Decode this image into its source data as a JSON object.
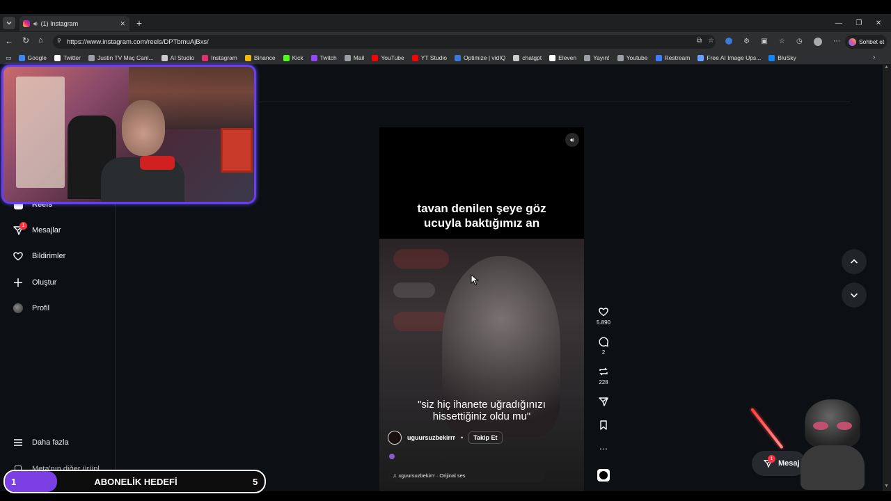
{
  "browser": {
    "tab_title": "(1) Instagram",
    "url": "https://www.instagram.com/reels/DPTbmuAjBxs/",
    "copilot_label": "Sohbet et",
    "bookmarks": [
      {
        "label": "Google",
        "color": "#4285f4"
      },
      {
        "label": "Twitter",
        "color": "#ffffff"
      },
      {
        "label": "Justin TV Maç Canl...",
        "color": "#9aa0a6"
      },
      {
        "label": "AI Studio",
        "color": "#cccccc"
      },
      {
        "label": "Instagram",
        "color": "#e1306c"
      },
      {
        "label": "Binance",
        "color": "#f0b90b"
      },
      {
        "label": "Kick",
        "color": "#53fc18"
      },
      {
        "label": "Twitch",
        "color": "#9146ff"
      },
      {
        "label": "Mail",
        "color": "#9aa0a6"
      },
      {
        "label": "YouTube",
        "color": "#ff0000"
      },
      {
        "label": "YT Studio",
        "color": "#ff0000"
      },
      {
        "label": "Optimize | vidIQ",
        "color": "#3c78d8"
      },
      {
        "label": "chatgpt",
        "color": "#cccccc"
      },
      {
        "label": "Eleven",
        "color": "#ffffff"
      },
      {
        "label": "Yayın!",
        "color": "#9aa0a6"
      },
      {
        "label": "Youtube",
        "color": "#9aa0a6"
      },
      {
        "label": "Restream",
        "color": "#3d7bff"
      },
      {
        "label": "Free AI Image Ups...",
        "color": "#6aa0ff"
      },
      {
        "label": "BluSky",
        "color": "#1185fe"
      }
    ]
  },
  "sidebar": {
    "partial_top_label": "Reels",
    "items": [
      {
        "label": "Mesajlar",
        "icon": "messenger-icon",
        "badge": "1"
      },
      {
        "label": "Bildirimler",
        "icon": "heart-icon"
      },
      {
        "label": "Oluştur",
        "icon": "plus-icon"
      },
      {
        "label": "Profil",
        "icon": "avatar"
      }
    ],
    "more_label": "Daha fazla",
    "meta_label": "Meta'nın diğer ürünl..."
  },
  "reel": {
    "caption_top": "tavan denilen şeye göz ucuyla baktığımız an",
    "caption_bottom": "\"siz hiç ihanete uğradığınızı hissettiğiniz oldu mu\"",
    "username": "uguursuzbekirrr",
    "follow_label": "Takip Et",
    "audio_label": "uguursuzbekirrr · Orijinal ses",
    "likes": "5.890",
    "comments": "2",
    "reposts": "228"
  },
  "overlay": {
    "goal_current": "1",
    "goal_label": "ABONELİK HEDEFİ",
    "goal_target": "5",
    "goal_progress": 0.2
  },
  "messages_pill": {
    "label": "Mesaj",
    "badge": "1"
  },
  "colors": {
    "page_bg": "#0c1014",
    "accent_purple": "#7b3fe4",
    "badge_red": "#ff3040"
  }
}
